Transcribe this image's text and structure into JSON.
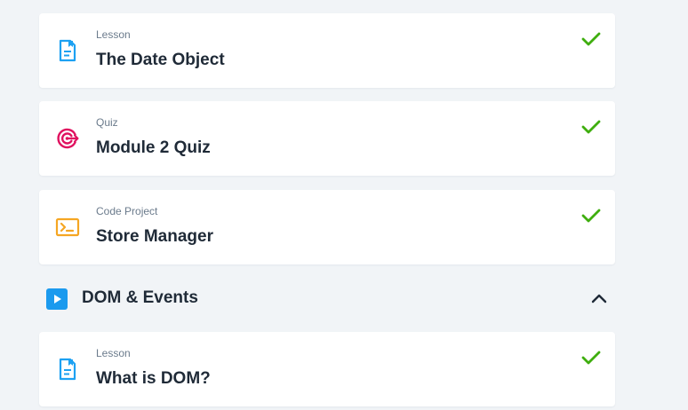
{
  "items": [
    {
      "type": "Lesson",
      "title": "The Date Object",
      "icon": "lesson-icon",
      "completed": true
    },
    {
      "type": "Quiz",
      "title": "Module 2 Quiz",
      "icon": "quiz-target-icon",
      "completed": true
    },
    {
      "type": "Code Project",
      "title": "Store Manager",
      "icon": "terminal-icon",
      "completed": true
    }
  ],
  "section": {
    "title": "DOM & Events",
    "icon": "play-icon",
    "expanded": true,
    "items": [
      {
        "type": "Lesson",
        "title": "What is DOM?",
        "icon": "lesson-icon",
        "completed": true
      }
    ]
  },
  "colors": {
    "background": "#f1f4f7",
    "lesson": "#1da1f2",
    "quiz": "#e0115f",
    "code_project": "#f5a623",
    "check": "#3fae0f",
    "section_icon": "#1b9aee"
  }
}
